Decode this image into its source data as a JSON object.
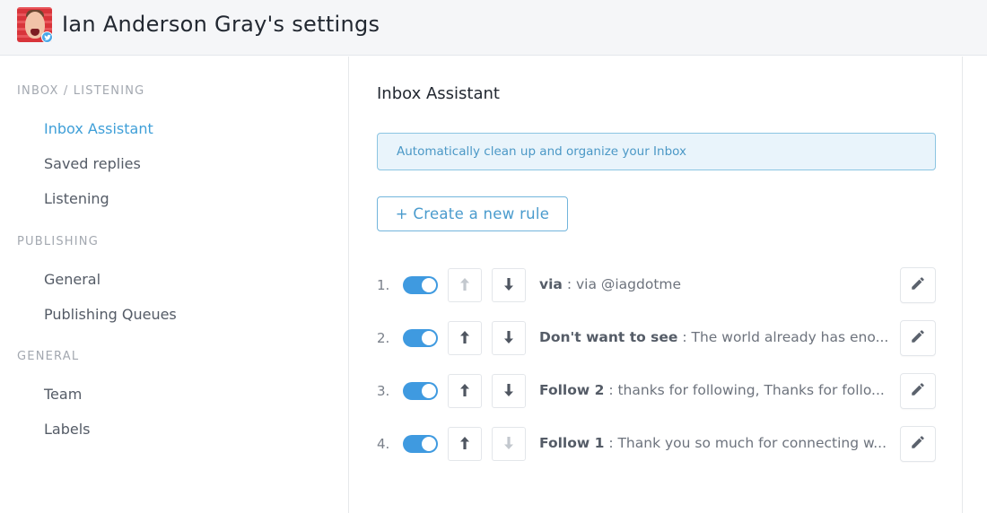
{
  "header": {
    "title": "Ian Anderson Gray's settings",
    "avatar_badge": "twitter-icon"
  },
  "sidebar": {
    "sections": [
      {
        "label": "INBOX / LISTENING",
        "items": [
          {
            "label": "Inbox Assistant",
            "active": true
          },
          {
            "label": "Saved replies",
            "active": false
          },
          {
            "label": "Listening",
            "active": false
          }
        ]
      },
      {
        "label": "PUBLISHING",
        "items": [
          {
            "label": "General",
            "active": false
          },
          {
            "label": "Publishing Queues",
            "active": false
          }
        ]
      },
      {
        "label": "GENERAL",
        "items": [
          {
            "label": "Team",
            "active": false
          },
          {
            "label": "Labels",
            "active": false
          }
        ]
      }
    ]
  },
  "main": {
    "title": "Inbox Assistant",
    "banner": "Automatically clean up and organize your Inbox",
    "create_button": "+ Create a new rule",
    "rules": [
      {
        "index": "1.",
        "enabled": true,
        "up_enabled": false,
        "down_enabled": true,
        "name": "via",
        "separator": " : ",
        "description": "via @iagdotme"
      },
      {
        "index": "2.",
        "enabled": true,
        "up_enabled": true,
        "down_enabled": true,
        "name": "Don't want to see",
        "separator": " : ",
        "description": "The world already has eno..."
      },
      {
        "index": "3.",
        "enabled": true,
        "up_enabled": true,
        "down_enabled": true,
        "name": "Follow 2",
        "separator": " : ",
        "description": "thanks for following, Thanks for follo..."
      },
      {
        "index": "4.",
        "enabled": true,
        "up_enabled": true,
        "down_enabled": false,
        "name": "Follow 1",
        "separator": " : ",
        "description": "Thank you so much for connecting w..."
      }
    ]
  },
  "colors": {
    "accent": "#3f9fd8",
    "toggle_on": "#3f9ae0",
    "banner_bg": "#e9f4fb",
    "banner_border": "#8cc5e2"
  }
}
